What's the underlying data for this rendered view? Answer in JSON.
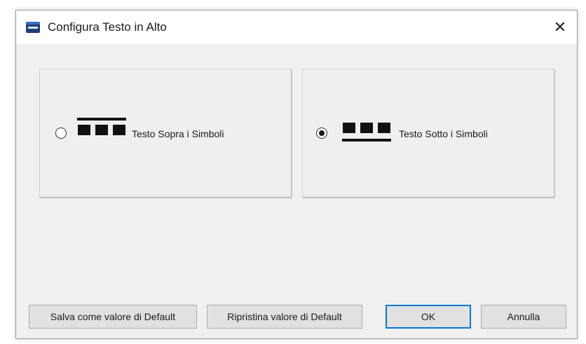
{
  "window": {
    "title": "Configura Testo in Alto",
    "close_symbol": "✕",
    "app_icon": "app-icon"
  },
  "options": [
    {
      "label": "Testo Sopra i Simboli",
      "selected": false,
      "glyph_icon": "text-above-symbols-icon"
    },
    {
      "label": "Testo Sotto i Simboli",
      "selected": true,
      "glyph_icon": "text-below-symbols-icon"
    }
  ],
  "buttons": {
    "save_default": "Salva come valore di Default",
    "restore_default": "Ripristina valore di Default",
    "ok": "OK",
    "cancel": "Annulla"
  },
  "colors": {
    "focus_border": "#0078d7",
    "dialog_background": "#f0f0f0",
    "app_icon": "#1f3d7a"
  }
}
